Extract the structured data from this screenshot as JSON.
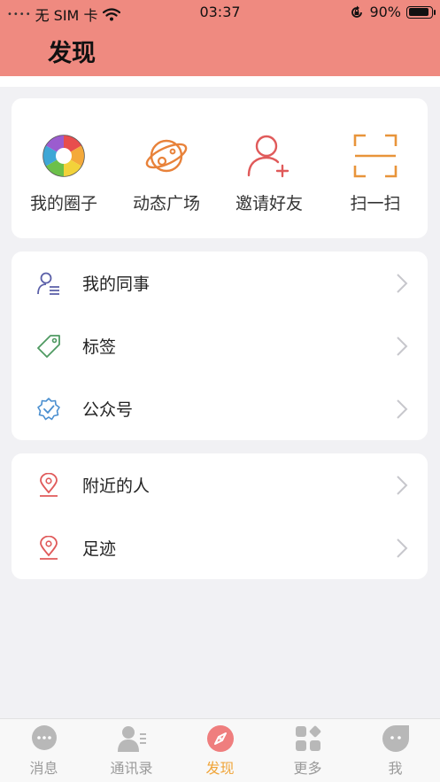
{
  "status_bar": {
    "signal": "••••",
    "carrier": "无 SIM 卡",
    "time": "03:37",
    "battery": "90%",
    "battery_level": 0.9
  },
  "header": {
    "title": "发现"
  },
  "grid": [
    {
      "label": "我的圈子",
      "icon": "aperture-icon"
    },
    {
      "label": "动态广场",
      "icon": "planet-icon"
    },
    {
      "label": "邀请好友",
      "icon": "add-user-icon"
    },
    {
      "label": "扫一扫",
      "icon": "scan-icon"
    }
  ],
  "list1": [
    {
      "label": "我的同事",
      "icon": "colleague-icon"
    },
    {
      "label": "标签",
      "icon": "tag-icon"
    },
    {
      "label": "公众号",
      "icon": "verified-badge-icon"
    }
  ],
  "list2": [
    {
      "label": "附近的人",
      "icon": "location-pin-icon"
    },
    {
      "label": "足迹",
      "icon": "location-pin-icon"
    }
  ],
  "tabs": [
    {
      "label": "消息",
      "icon": "chat-bubble-icon",
      "active": false
    },
    {
      "label": "通讯录",
      "icon": "contacts-icon",
      "active": false
    },
    {
      "label": "发现",
      "icon": "compass-icon",
      "active": true
    },
    {
      "label": "更多",
      "icon": "apps-grid-icon",
      "active": false
    },
    {
      "label": "我",
      "icon": "profile-face-icon",
      "active": false
    }
  ],
  "colors": {
    "header": "#ef8a80",
    "accent": "#f0a53a",
    "tab_inactive": "#9a9a9a"
  }
}
